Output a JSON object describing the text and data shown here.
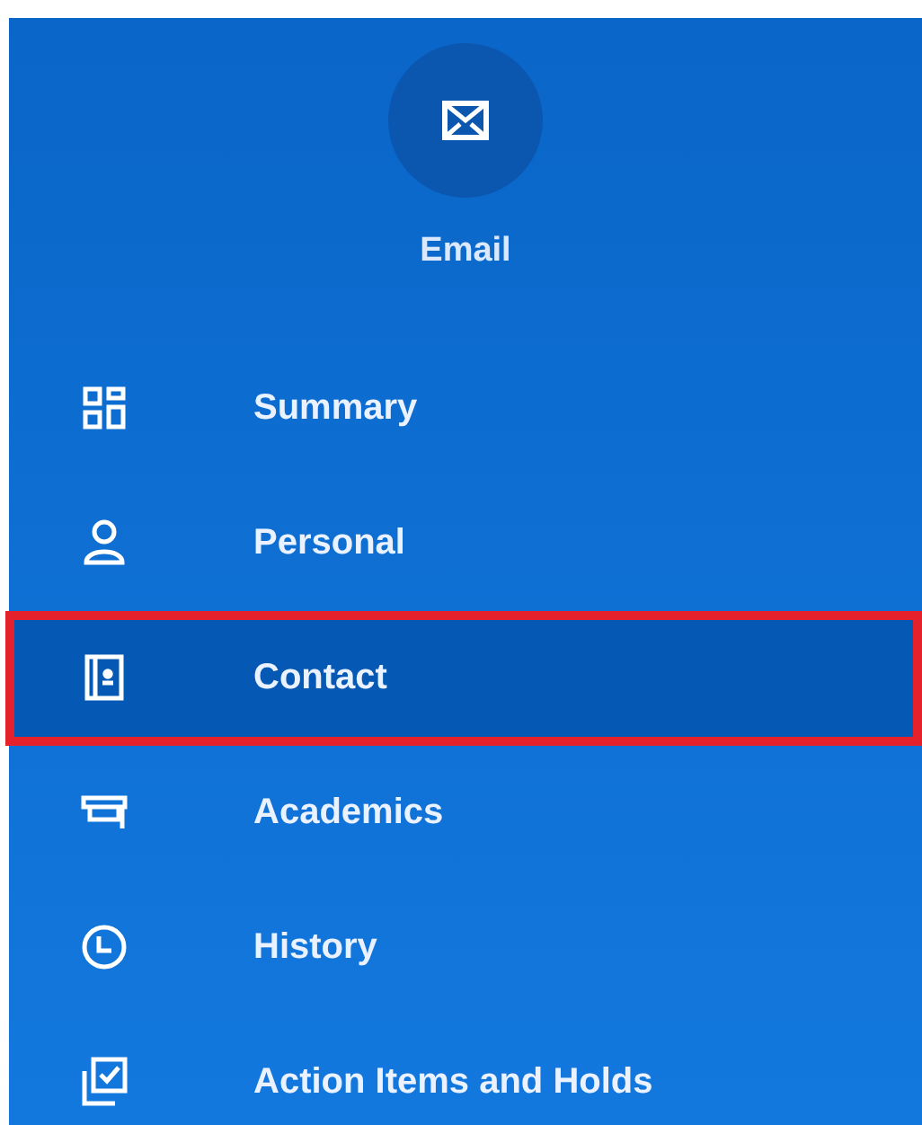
{
  "header": {
    "label": "Email"
  },
  "nav_items": [
    {
      "label": "Summary",
      "selected": false
    },
    {
      "label": "Personal",
      "selected": false
    },
    {
      "label": "Contact",
      "selected": true
    },
    {
      "label": "Academics",
      "selected": false
    },
    {
      "label": "History",
      "selected": false
    },
    {
      "label": "Action Items and Holds",
      "selected": false
    }
  ]
}
